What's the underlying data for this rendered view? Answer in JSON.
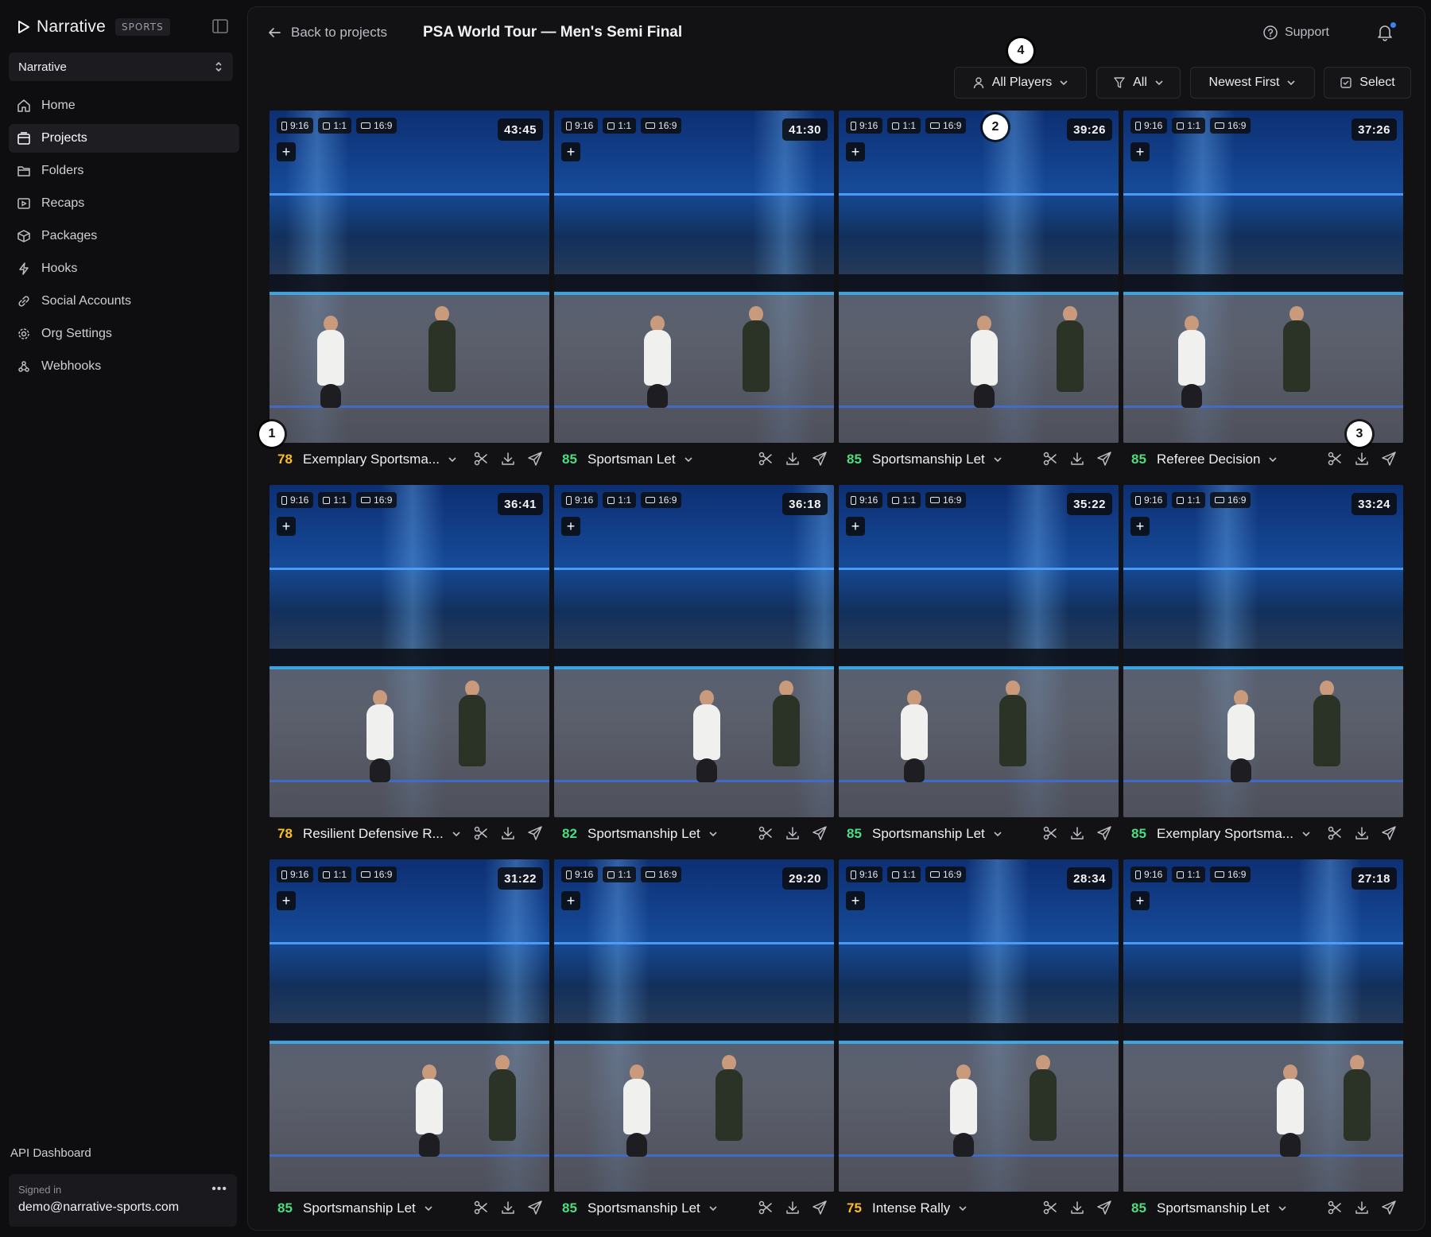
{
  "sidebar": {
    "brand": "Narrative",
    "brand_tag": "SPORTS",
    "org": "Narrative",
    "items": [
      {
        "label": "Home",
        "icon": "home-icon"
      },
      {
        "label": "Projects",
        "icon": "projects-icon",
        "active": true
      },
      {
        "label": "Folders",
        "icon": "folder-icon"
      },
      {
        "label": "Recaps",
        "icon": "recaps-icon"
      },
      {
        "label": "Packages",
        "icon": "package-icon"
      },
      {
        "label": "Hooks",
        "icon": "bolt-icon"
      },
      {
        "label": "Social Accounts",
        "icon": "link-icon"
      },
      {
        "label": "Org Settings",
        "icon": "gear-icon"
      },
      {
        "label": "Webhooks",
        "icon": "webhook-icon"
      }
    ],
    "api_dashboard": "API Dashboard",
    "signed_in_label": "Signed in",
    "signed_in_email": "demo@narrative-sports.com",
    "more_label": "•••"
  },
  "topbar": {
    "back_label": "Back to projects",
    "title": "PSA World Tour — Men's Semi Final",
    "support_label": "Support"
  },
  "filters": {
    "players": "All Players",
    "filter": "All",
    "sort": "Newest First",
    "select": "Select"
  },
  "badges": [
    "1",
    "2",
    "3",
    "4"
  ],
  "ratio_labels": [
    "9:16",
    "1:1",
    "16:9"
  ],
  "colors": {
    "score_green": "#4ade80",
    "score_yellow": "#fbbf24",
    "accent_blue": "#3b82f6"
  },
  "clips": [
    {
      "duration": "43:45",
      "score": "78",
      "level": "y",
      "title": "Exemplary Sportsma..."
    },
    {
      "duration": "41:30",
      "score": "85",
      "level": "g",
      "title": "Sportsman Let"
    },
    {
      "duration": "39:26",
      "score": "85",
      "level": "g",
      "title": "Sportsmanship Let"
    },
    {
      "duration": "37:26",
      "score": "85",
      "level": "g",
      "title": "Referee Decision"
    },
    {
      "duration": "36:41",
      "score": "78",
      "level": "y",
      "title": "Resilient Defensive R..."
    },
    {
      "duration": "36:18",
      "score": "82",
      "level": "g",
      "title": "Sportsmanship Let"
    },
    {
      "duration": "35:22",
      "score": "85",
      "level": "g",
      "title": "Sportsmanship Let"
    },
    {
      "duration": "33:24",
      "score": "85",
      "level": "g",
      "title": "Exemplary Sportsma..."
    },
    {
      "duration": "31:22",
      "score": "85",
      "level": "g",
      "title": "Sportsmanship Let"
    },
    {
      "duration": "29:20",
      "score": "85",
      "level": "g",
      "title": "Sportsmanship Let"
    },
    {
      "duration": "28:34",
      "score": "75",
      "level": "y",
      "title": "Intense Rally"
    },
    {
      "duration": "27:18",
      "score": "85",
      "level": "g",
      "title": "Sportsmanship Let"
    }
  ]
}
